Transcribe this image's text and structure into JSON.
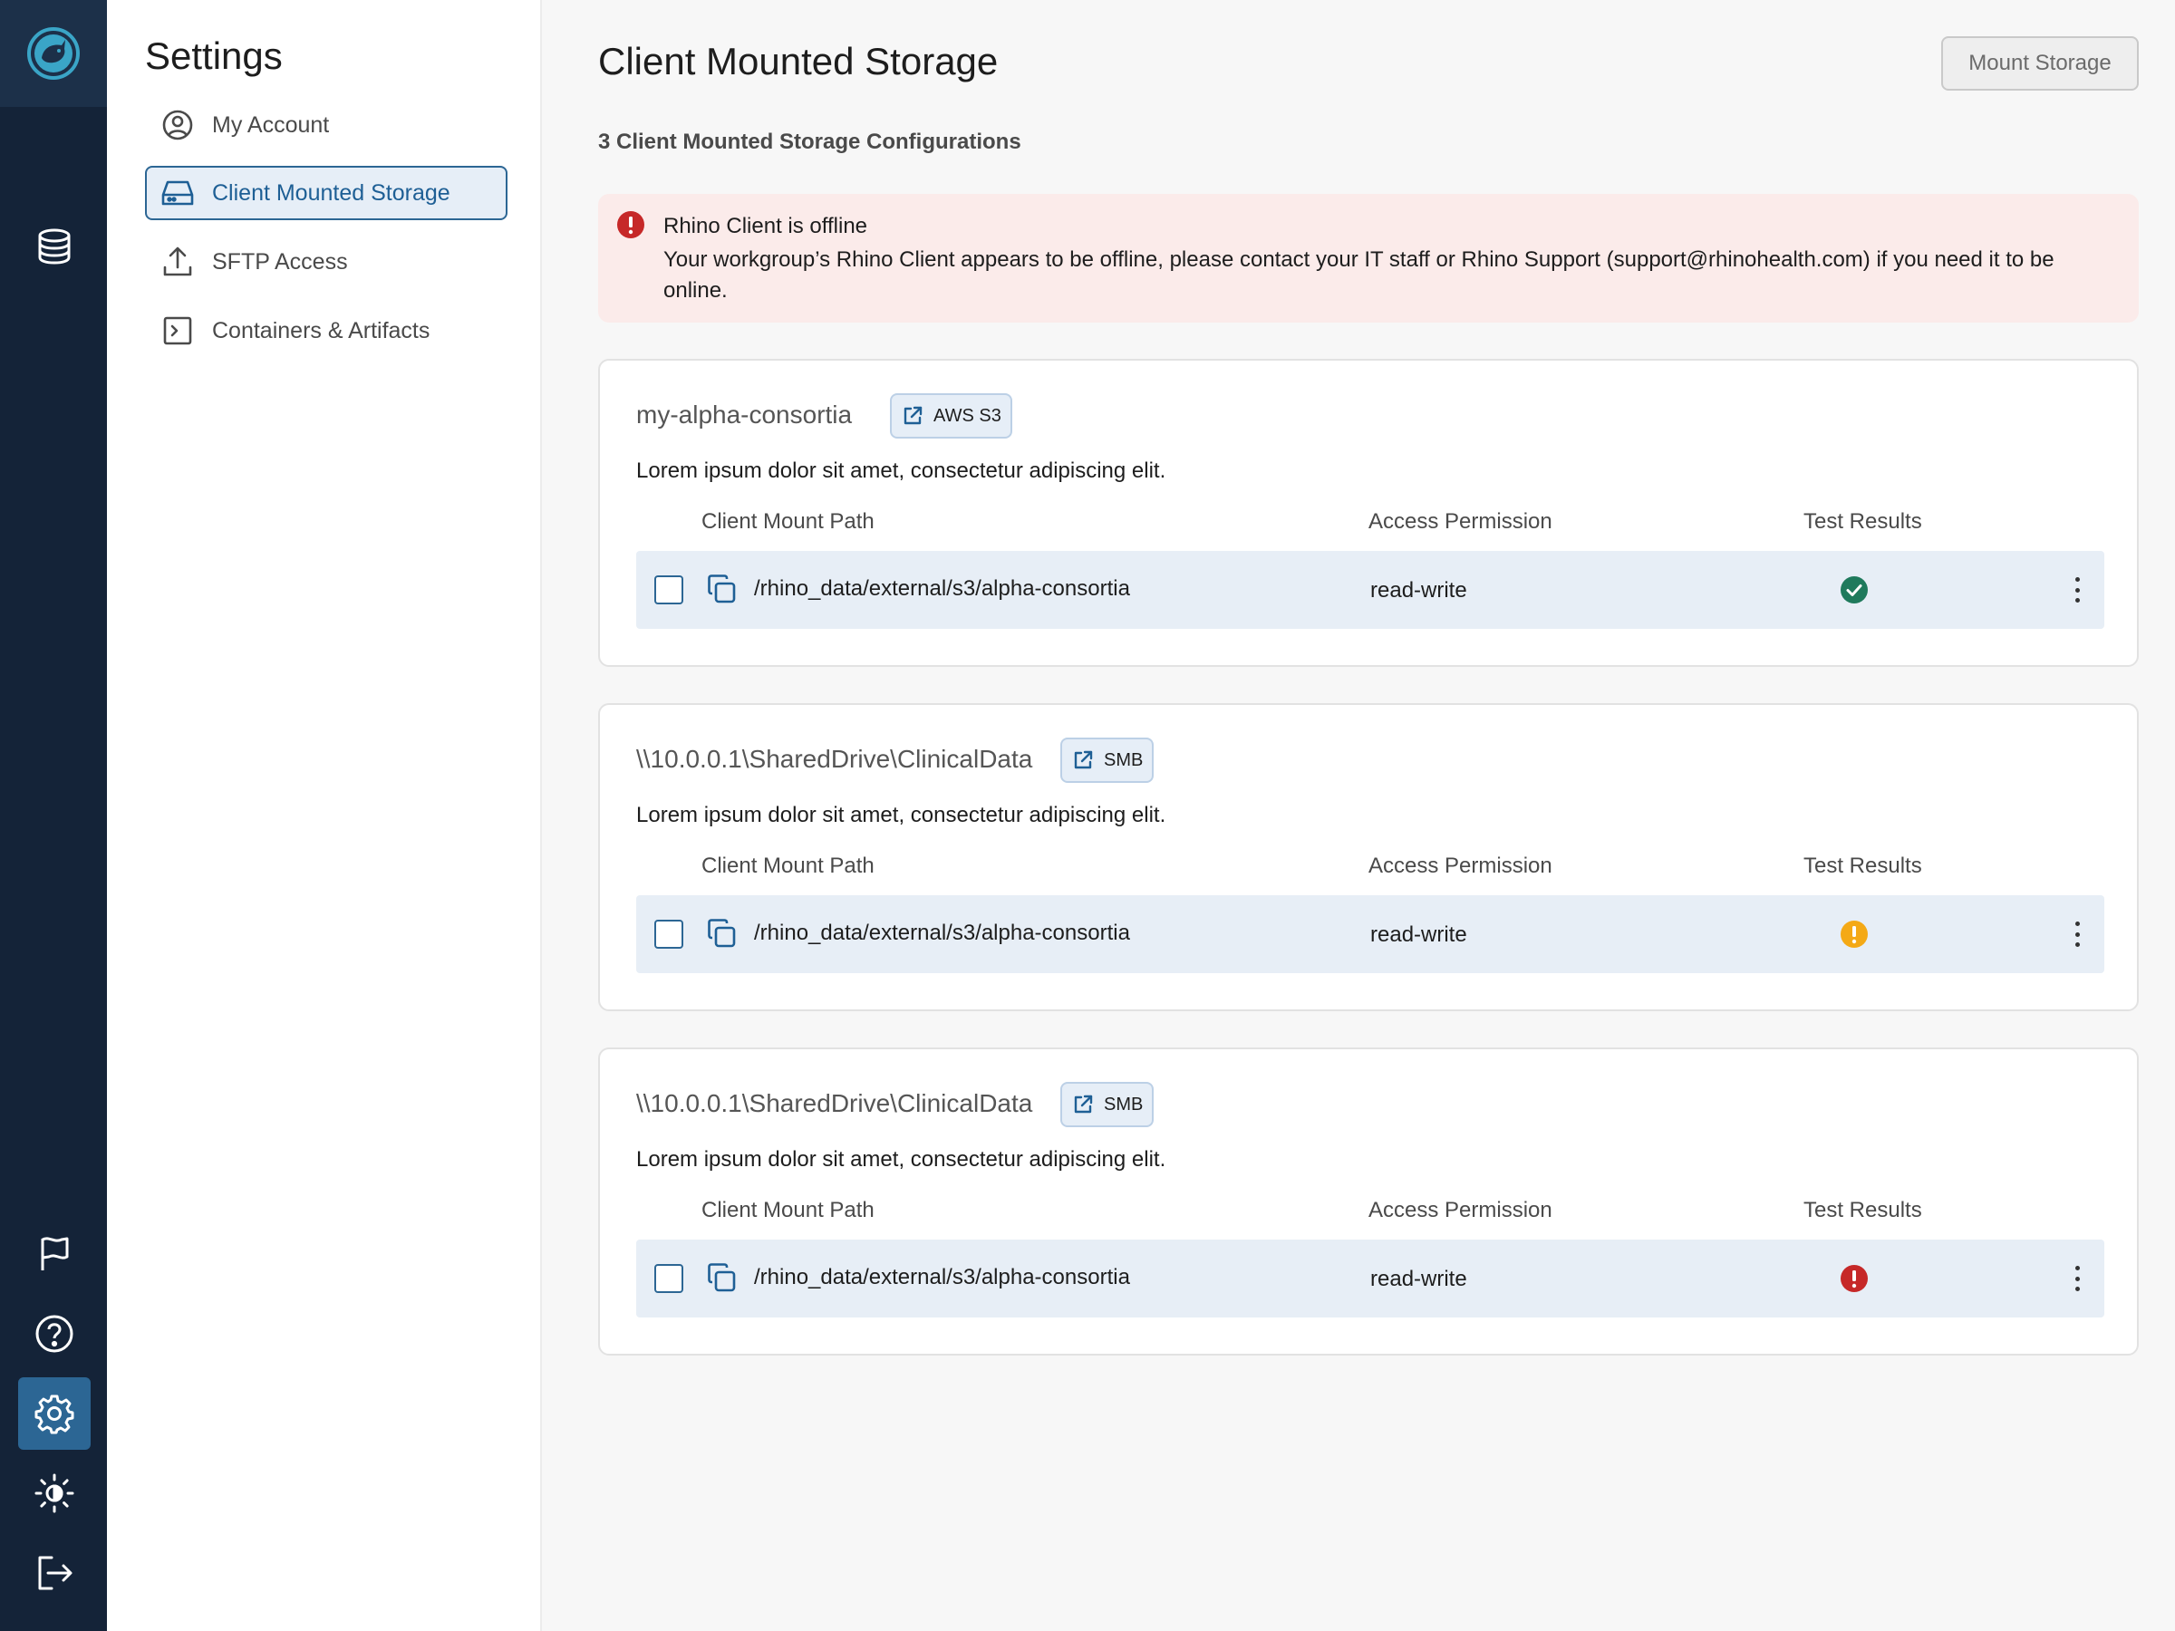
{
  "rail": {
    "icons": [
      "logo-icon",
      "database-icon",
      "flag-icon",
      "help-icon",
      "gear-icon",
      "brightness-icon",
      "logout-icon"
    ],
    "active": "gear-icon"
  },
  "settings": {
    "title": "Settings",
    "items": [
      {
        "label": "My Account",
        "icon": "user-circle-icon"
      },
      {
        "label": "Client Mounted Storage",
        "icon": "drive-icon",
        "active": true
      },
      {
        "label": "SFTP Access",
        "icon": "upload-icon"
      },
      {
        "label": "Containers & Artifacts",
        "icon": "terminal-icon"
      }
    ]
  },
  "main": {
    "title": "Client Mounted Storage",
    "mount_button": "Mount Storage",
    "config_count": "3 Client Mounted Storage Configurations",
    "alert": {
      "title": "Rhino Client is offline",
      "body": "Your workgroup’s Rhino Client appears to be offline, please contact your IT staff or Rhino Support (support@rhinohealth.com) if you need it to be online."
    },
    "columns": {
      "path": "Client Mount Path",
      "permission": "Access Permission",
      "results": "Test Results"
    },
    "cards": [
      {
        "title": "my-alpha-consortia",
        "tag": "AWS S3",
        "description": "Lorem ipsum dolor sit amet, consectetur adipiscing elit.",
        "row": {
          "path": "/rhino_data/external/s3/alpha-consortia",
          "permission": "read-write",
          "status": "success"
        }
      },
      {
        "title": "\\\\10.0.0.1\\SharedDrive\\ClinicalData",
        "tag": "SMB",
        "description": "Lorem ipsum dolor sit amet, consectetur adipiscing elit.",
        "row": {
          "path": "/rhino_data/external/s3/alpha-consortia",
          "permission": "read-write",
          "status": "warning"
        }
      },
      {
        "title": "\\\\10.0.0.1\\SharedDrive\\ClinicalData",
        "tag": "SMB",
        "description": "Lorem ipsum dolor sit amet, consectetur adipiscing elit.",
        "row": {
          "path": "/rhino_data/external/s3/alpha-consortia",
          "permission": "read-write",
          "status": "error"
        }
      }
    ]
  },
  "colors": {
    "rail_bg": "#142338",
    "accent": "#2c6694",
    "success": "#1f7a5c",
    "warning": "#f4a916",
    "error": "#c62828",
    "alert_bg": "#fbebea",
    "row_bg": "#e7eef6"
  }
}
